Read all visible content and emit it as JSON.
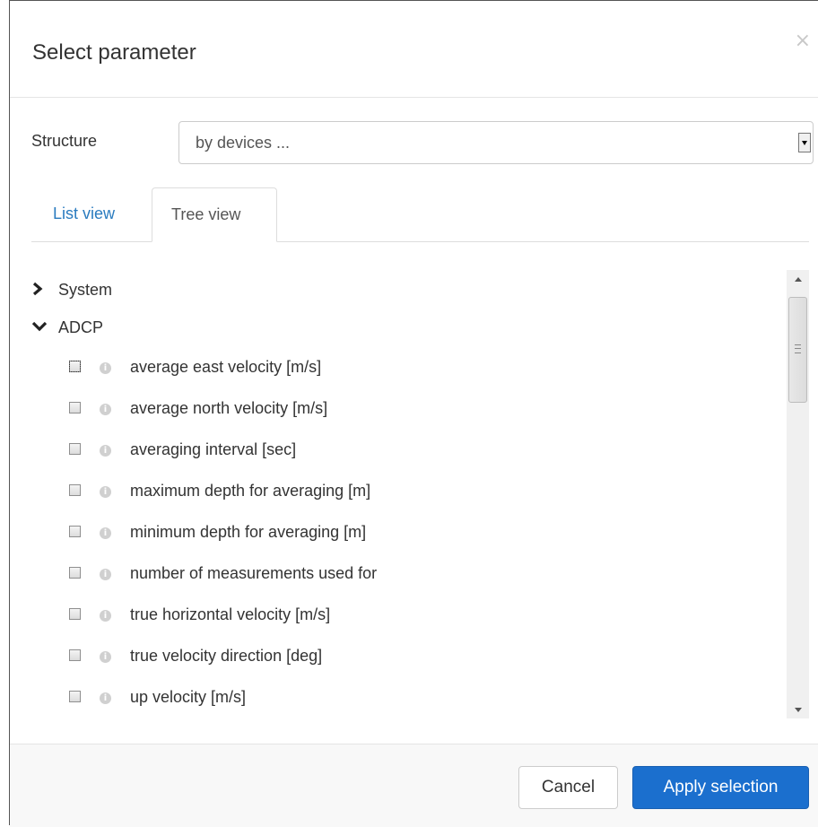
{
  "dialog": {
    "title": "Select parameter",
    "close_symbol": "×"
  },
  "structure": {
    "label": "Structure",
    "selected": "by devices ..."
  },
  "tabs": [
    {
      "label": "List view",
      "active": false
    },
    {
      "label": "Tree view",
      "active": true
    }
  ],
  "tree": {
    "nodes": [
      {
        "label": "System",
        "expanded": false
      },
      {
        "label": "ADCP",
        "expanded": true
      }
    ],
    "params": [
      "average east velocity [m/s]",
      "average north velocity [m/s]",
      "averaging interval [sec]",
      "maximum depth for averaging [m]",
      "minimum depth for averaging [m]",
      "number of measurements used for",
      "true horizontal velocity [m/s]",
      "true velocity direction [deg]",
      "up velocity [m/s]"
    ]
  },
  "footer": {
    "cancel_label": "Cancel",
    "apply_label": "Apply selection"
  },
  "colors": {
    "accent": "#1b6fce",
    "link": "#2a7bbf"
  }
}
